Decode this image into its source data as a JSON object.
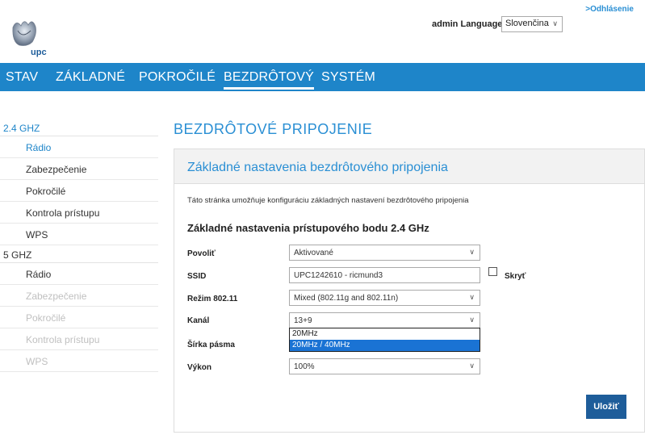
{
  "header": {
    "logo_text": "upc",
    "logout_label": ">Odhlásenie",
    "user": "admin",
    "language_label": "Language",
    "language_value": "Slovenčina"
  },
  "nav": {
    "items": [
      {
        "label": "STAV"
      },
      {
        "label": "ZÁKLADNÉ"
      },
      {
        "label": "POKROČILÉ"
      },
      {
        "label": "BEZDRÔTOVÝ"
      },
      {
        "label": "SYSTÉM"
      }
    ],
    "active": "BEZDRÔTOVÝ"
  },
  "sidebar": {
    "group_24": "2.4 GHZ",
    "items_24": [
      {
        "label": "Rádio"
      },
      {
        "label": "Zabezpečenie"
      },
      {
        "label": "Pokročilé"
      },
      {
        "label": "Kontrola prístupu"
      },
      {
        "label": "WPS"
      }
    ],
    "group_5": "5 GHZ",
    "items_5": [
      {
        "label": "Rádio"
      },
      {
        "label": "Zabezpečenie"
      },
      {
        "label": "Pokročilé"
      },
      {
        "label": "Kontrola prístupu"
      },
      {
        "label": "WPS"
      }
    ]
  },
  "main": {
    "page_title": "BEZDRÔTOVÉ PRIPOJENIE",
    "panel_title": "Základné nastavenia bezdrôtového pripojenia",
    "description": "Táto stránka umožňuje konfiguráciu základných nastavení bezdrôtového pripojenia",
    "section_title": "Základné nastavenia prístupového bodu 2.4 GHz",
    "fields": {
      "enable_label": "Povoliť",
      "enable_value": "Aktivované",
      "ssid_label": "SSID",
      "ssid_value": "UPC1242610 - ricmund3",
      "hide_label": "Skryť",
      "mode_label": "Režim 802.11",
      "mode_value": "Mixed (802.11g and 802.11n)",
      "channel_label": "Kanál",
      "channel_value": "13+9",
      "bandwidth_label": "Šírka pásma",
      "bandwidth_options": [
        "20MHz",
        "20MHz / 40MHz"
      ],
      "power_label": "Výkon",
      "power_value": "100%"
    },
    "save_label": "Uložiť"
  },
  "colors": {
    "nav_bg": "#1e85c9",
    "accent": "#2a8fd4",
    "button": "#1e5d9a",
    "dropdown_selected": "#1a73d4"
  }
}
